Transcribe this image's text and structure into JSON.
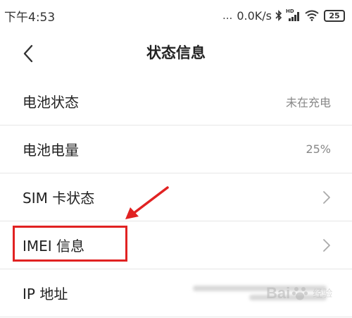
{
  "status_bar": {
    "time": "下午4:53",
    "dots": "...",
    "net_speed": "0.0K/s",
    "signal_label": "HD",
    "battery": "25"
  },
  "header": {
    "title": "状态信息"
  },
  "rows": [
    {
      "label": "电池状态",
      "value": "未在充电"
    },
    {
      "label": "电池电量",
      "value": "25%"
    },
    {
      "label": "SIM 卡状态"
    },
    {
      "label": "IMEI 信息"
    },
    {
      "label": "IP 地址"
    }
  ],
  "annotation": {
    "color": "#e12222"
  },
  "watermark": {
    "text": "Bai",
    "sub": "经验"
  }
}
